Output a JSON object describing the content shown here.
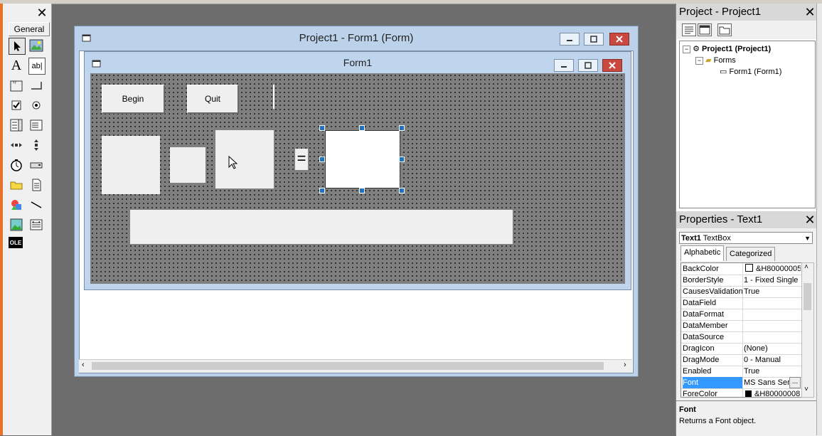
{
  "toolbox": {
    "close": "✕",
    "tab_label": "General",
    "tools": [
      {
        "name": "pointer-icon"
      },
      {
        "name": "picturebox-icon"
      },
      {
        "name": "label-tool-icon",
        "glyph": "A"
      },
      {
        "name": "textbox-tool-icon",
        "glyph": "ab|"
      },
      {
        "name": "frame-tool-icon"
      },
      {
        "name": "commandbutton-tool-icon"
      },
      {
        "name": "checkbox-tool-icon"
      },
      {
        "name": "optionbutton-tool-icon"
      },
      {
        "name": "combobox-tool-icon"
      },
      {
        "name": "listbox-tool-icon"
      },
      {
        "name": "hscrollbar-tool-icon"
      },
      {
        "name": "vscrollbar-tool-icon"
      },
      {
        "name": "timer-tool-icon"
      },
      {
        "name": "drivelistbox-tool-icon"
      },
      {
        "name": "dirlistbox-tool-icon"
      },
      {
        "name": "filelistbox-tool-icon"
      },
      {
        "name": "shape-tool-icon"
      },
      {
        "name": "line-tool-icon"
      },
      {
        "name": "image-tool-icon"
      },
      {
        "name": "data-tool-icon"
      },
      {
        "name": "ole-tool-icon",
        "glyph": "OLE"
      }
    ]
  },
  "project_window": {
    "title": "Project1 - Form1 (Form)"
  },
  "form": {
    "title": "Form1",
    "begin_label": "Begin",
    "quit_label": "Quit",
    "equals_label": "="
  },
  "project_panel": {
    "title": "Project - Project1",
    "close": "✕",
    "tree": {
      "root": "Project1 (Project1)",
      "folder": "Forms",
      "item": "Form1 (Form1)"
    }
  },
  "properties_panel": {
    "title": "Properties - Text1",
    "close": "✕",
    "object_name": "Text1",
    "object_type": "TextBox",
    "tabs": [
      "Alphabetic",
      "Categorized"
    ],
    "rows": [
      {
        "name": "BackColor",
        "value": "&H80000005"
      },
      {
        "name": "BorderStyle",
        "value": "1 - Fixed Single"
      },
      {
        "name": "CausesValidation",
        "value": "True"
      },
      {
        "name": "DataField",
        "value": ""
      },
      {
        "name": "DataFormat",
        "value": ""
      },
      {
        "name": "DataMember",
        "value": ""
      },
      {
        "name": "DataSource",
        "value": ""
      },
      {
        "name": "DragIcon",
        "value": "(None)"
      },
      {
        "name": "DragMode",
        "value": "0 - Manual"
      },
      {
        "name": "Enabled",
        "value": "True"
      },
      {
        "name": "Font",
        "value": "MS Sans Seri"
      },
      {
        "name": "ForeColor",
        "value": "&H80000008"
      }
    ],
    "ellipsis": "...",
    "description_title": "Font",
    "description_text": "Returns a Font object.",
    "colors": {
      "selection": "#3399ff"
    }
  }
}
